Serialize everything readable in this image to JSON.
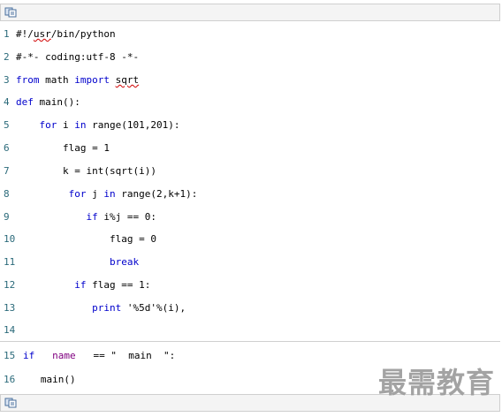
{
  "toolbar": {
    "copy_icon": "copy-code-icon"
  },
  "code": {
    "lines": [
      {
        "n": "1",
        "parts": [
          {
            "t": "#!/"
          },
          {
            "t": "usr",
            "sq": true
          },
          {
            "t": "/bin/python"
          }
        ]
      },
      {
        "n": "2",
        "parts": [
          {
            "t": "#-*- coding:utf-8 -*-"
          }
        ]
      },
      {
        "n": "3",
        "parts": [
          {
            "t": "from",
            "c": "kw"
          },
          {
            "t": " math "
          },
          {
            "t": "import",
            "c": "kw"
          },
          {
            "t": " "
          },
          {
            "t": "sqrt",
            "sq": true
          }
        ]
      },
      {
        "n": "4",
        "parts": [
          {
            "t": "def",
            "c": "kw"
          },
          {
            "t": " main():"
          }
        ]
      },
      {
        "n": "5",
        "parts": [
          {
            "t": "    "
          },
          {
            "t": "for",
            "c": "kw"
          },
          {
            "t": " i "
          },
          {
            "t": "in",
            "c": "kw"
          },
          {
            "t": " range(101,201):"
          }
        ]
      },
      {
        "n": "6",
        "parts": [
          {
            "t": "        flag = 1"
          }
        ]
      },
      {
        "n": "7",
        "parts": [
          {
            "t": "        k = int(sqrt(i))"
          }
        ]
      },
      {
        "n": "8",
        "parts": [
          {
            "t": "         "
          },
          {
            "t": "for",
            "c": "kw"
          },
          {
            "t": " j "
          },
          {
            "t": "in",
            "c": "kw"
          },
          {
            "t": " range(2,k+1):"
          }
        ]
      },
      {
        "n": "9",
        "parts": [
          {
            "t": "            "
          },
          {
            "t": "if",
            "c": "kw"
          },
          {
            "t": " i%j == 0:"
          }
        ]
      },
      {
        "n": "10",
        "parts": [
          {
            "t": "                flag = 0"
          }
        ]
      },
      {
        "n": "11",
        "parts": [
          {
            "t": "                "
          },
          {
            "t": "break",
            "c": "kw"
          }
        ]
      },
      {
        "n": "12",
        "parts": [
          {
            "t": "          "
          },
          {
            "t": "if",
            "c": "kw"
          },
          {
            "t": " flag == 1:"
          }
        ]
      },
      {
        "n": "13",
        "parts": [
          {
            "t": "             "
          },
          {
            "t": "print",
            "c": "kw"
          },
          {
            "t": " '%5d'%(i),"
          }
        ]
      },
      {
        "n": "14",
        "parts": [
          {
            "t": ""
          }
        ]
      },
      {
        "n": "15",
        "parts": [
          {
            "t": "if",
            "c": "kw"
          },
          {
            "t": "   "
          },
          {
            "t": "name",
            "c": "var"
          },
          {
            "t": "   == \"  main  \":"
          }
        ]
      },
      {
        "n": "16",
        "parts": [
          {
            "t": "   main()"
          }
        ]
      }
    ]
  },
  "watermark": "最需教育"
}
